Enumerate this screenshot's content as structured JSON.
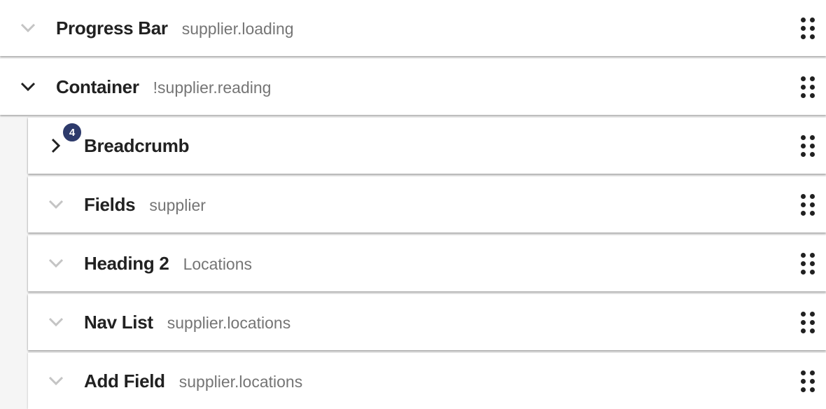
{
  "rows": [
    {
      "title": "Progress Bar",
      "subtitle": "supplier.loading",
      "expanded": false,
      "level": 0
    },
    {
      "title": "Container",
      "subtitle": "!supplier.reading",
      "expanded": true,
      "level": 0
    },
    {
      "title": "Breadcrumb",
      "subtitle": "",
      "expanded": false,
      "level": 1,
      "badge": "4"
    },
    {
      "title": "Fields",
      "subtitle": "supplier",
      "expanded": false,
      "level": 1
    },
    {
      "title": "Heading 2",
      "subtitle": "Locations",
      "expanded": false,
      "level": 1
    },
    {
      "title": "Nav List",
      "subtitle": "supplier.locations",
      "expanded": false,
      "level": 1
    },
    {
      "title": "Add Field",
      "subtitle": "supplier.locations",
      "expanded": false,
      "level": 1
    }
  ],
  "colors": {
    "badge": "#2d3a6b",
    "chevron_muted": "#bdbdbd",
    "chevron_active": "#212121"
  }
}
